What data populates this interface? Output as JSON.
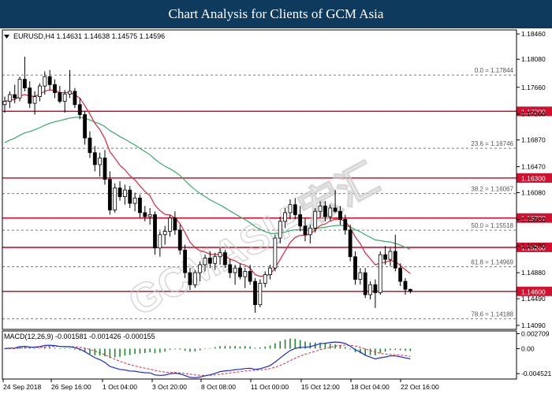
{
  "banner": {
    "title": "Chart Analysis for Clients of GCM Asia"
  },
  "watermark": {
    "text": "GCMASIA宏汇"
  },
  "chart_data": [
    {
      "type": "candlestick",
      "title": "EURUSD,H4  1.14631 1.14638 1.14575 1.14596",
      "symbol": "EURUSD,H4",
      "ohlc_header": [
        "1.14631",
        "1.14638",
        "1.14575",
        "1.14596"
      ],
      "ylim": [
        1.1403,
        1.1852
      ],
      "y_ticks": [
        "1.18460",
        "1.18080",
        "1.17660",
        "1.17260",
        "1.16870",
        "1.16470",
        "1.16080",
        "1.15680",
        "1.15280",
        "1.14880",
        "1.14490",
        "1.14090"
      ],
      "x_labels": [
        "24 Sep 2018",
        "26 Sep 16:00",
        "1 Oct 04:00",
        "3 Oct 20:00",
        "8 Oct 08:00",
        "11 Oct 00:00",
        "15 Oct 12:00",
        "18 Oct 04:00",
        "22 Oct 16:00"
      ],
      "levels": [
        {
          "label": "1.17300",
          "value": 1.173
        },
        {
          "label": "1.16300",
          "value": 1.163
        },
        {
          "label": "1.15700",
          "value": 1.157
        },
        {
          "label": "1.15260",
          "value": 1.1526
        },
        {
          "label": "1.14600",
          "value": 1.146
        }
      ],
      "fibonacci": [
        {
          "label": "0.0 = 1.17844",
          "value": 1.17844
        },
        {
          "label": "23.6 = 1.16746",
          "value": 1.16746
        },
        {
          "label": "38.2 = 1.16067",
          "value": 1.16067
        },
        {
          "label": "50.0 = 1.15518",
          "value": 1.15518
        },
        {
          "label": "61.8 = 1.14969",
          "value": 1.14969
        },
        {
          "label": "78.6 = 1.14188",
          "value": 1.14188
        }
      ],
      "candles": [
        [
          1.174,
          1.1752,
          1.1728,
          1.1745
        ],
        [
          1.1745,
          1.176,
          1.1735,
          1.1755
        ],
        [
          1.1755,
          1.177,
          1.1742,
          1.175
        ],
        [
          1.175,
          1.1782,
          1.1745,
          1.1778
        ],
        [
          1.1778,
          1.1812,
          1.176,
          1.1765
        ],
        [
          1.1765,
          1.1775,
          1.1735,
          1.1742
        ],
        [
          1.1742,
          1.176,
          1.1725,
          1.1752
        ],
        [
          1.1752,
          1.1772,
          1.1745,
          1.1768
        ],
        [
          1.1768,
          1.179,
          1.1755,
          1.1782
        ],
        [
          1.1782,
          1.1792,
          1.1762,
          1.177
        ],
        [
          1.177,
          1.1778,
          1.175,
          1.1758
        ],
        [
          1.1758,
          1.1768,
          1.1742,
          1.1745
        ],
        [
          1.1745,
          1.1762,
          1.1728,
          1.1756
        ],
        [
          1.1756,
          1.1792,
          1.175,
          1.176
        ],
        [
          1.176,
          1.1765,
          1.1735,
          1.174
        ],
        [
          1.174,
          1.175,
          1.1718,
          1.1725
        ],
        [
          1.1725,
          1.173,
          1.168,
          1.169
        ],
        [
          1.169,
          1.17,
          1.166,
          1.1668
        ],
        [
          1.1668,
          1.1678,
          1.164,
          1.165
        ],
        [
          1.165,
          1.1668,
          1.1632,
          1.166
        ],
        [
          1.166,
          1.1672,
          1.162,
          1.1628
        ],
        [
          1.1628,
          1.164,
          1.1575,
          1.1582
        ],
        [
          1.1582,
          1.1622,
          1.1578,
          1.1615
        ],
        [
          1.1615,
          1.1625,
          1.1596,
          1.1602
        ],
        [
          1.1602,
          1.162,
          1.159,
          1.1612
        ],
        [
          1.1612,
          1.1618,
          1.1585,
          1.1592
        ],
        [
          1.1592,
          1.1608,
          1.158,
          1.16
        ],
        [
          1.16,
          1.1605,
          1.157,
          1.1578
        ],
        [
          1.1578,
          1.1588,
          1.1565,
          1.1572
        ],
        [
          1.1572,
          1.1585,
          1.156,
          1.1575
        ],
        [
          1.1575,
          1.158,
          1.1515,
          1.1525
        ],
        [
          1.1525,
          1.155,
          1.1512,
          1.1545
        ],
        [
          1.1545,
          1.1558,
          1.153,
          1.155
        ],
        [
          1.155,
          1.1575,
          1.1542,
          1.157
        ],
        [
          1.157,
          1.158,
          1.1545,
          1.1552
        ],
        [
          1.1552,
          1.156,
          1.1515,
          1.1522
        ],
        [
          1.1522,
          1.153,
          1.148,
          1.1488
        ],
        [
          1.1488,
          1.1495,
          1.1462,
          1.147
        ],
        [
          1.147,
          1.1492,
          1.1465,
          1.1488
        ],
        [
          1.1488,
          1.1505,
          1.1475,
          1.15
        ],
        [
          1.15,
          1.1515,
          1.149,
          1.151
        ],
        [
          1.151,
          1.152,
          1.1495,
          1.1502
        ],
        [
          1.1502,
          1.1518,
          1.1492,
          1.1512
        ],
        [
          1.1512,
          1.1525,
          1.15,
          1.1518
        ],
        [
          1.1518,
          1.1522,
          1.1495,
          1.15
        ],
        [
          1.15,
          1.1508,
          1.148,
          1.1488
        ],
        [
          1.1488,
          1.15,
          1.147,
          1.1495
        ],
        [
          1.1495,
          1.1502,
          1.1478,
          1.1482
        ],
        [
          1.1482,
          1.1495,
          1.1465,
          1.149
        ],
        [
          1.149,
          1.15,
          1.147,
          1.1475
        ],
        [
          1.1475,
          1.148,
          1.1428,
          1.144
        ],
        [
          1.144,
          1.1478,
          1.1436,
          1.1472
        ],
        [
          1.1472,
          1.149,
          1.1466,
          1.1485
        ],
        [
          1.1485,
          1.15,
          1.1478,
          1.1495
        ],
        [
          1.1495,
          1.1545,
          1.149,
          1.154
        ],
        [
          1.154,
          1.1572,
          1.1532,
          1.1565
        ],
        [
          1.1565,
          1.1585,
          1.1555,
          1.1578
        ],
        [
          1.1578,
          1.1598,
          1.1568,
          1.159
        ],
        [
          1.159,
          1.16,
          1.1568,
          1.1575
        ],
        [
          1.1575,
          1.1588,
          1.155,
          1.1558
        ],
        [
          1.1558,
          1.157,
          1.1535,
          1.1545
        ],
        [
          1.1545,
          1.156,
          1.1532,
          1.1555
        ],
        [
          1.1555,
          1.1585,
          1.1548,
          1.158
        ],
        [
          1.158,
          1.1595,
          1.157,
          1.1588
        ],
        [
          1.1588,
          1.1595,
          1.1565,
          1.1572
        ],
        [
          1.1572,
          1.159,
          1.1566,
          1.1585
        ],
        [
          1.1585,
          1.1612,
          1.1578,
          1.158
        ],
        [
          1.158,
          1.1588,
          1.156,
          1.1568
        ],
        [
          1.1568,
          1.1575,
          1.1545,
          1.1552
        ],
        [
          1.1552,
          1.156,
          1.1505,
          1.1512
        ],
        [
          1.1512,
          1.152,
          1.147,
          1.1478
        ],
        [
          1.1478,
          1.1495,
          1.147,
          1.1488
        ],
        [
          1.1488,
          1.1495,
          1.145,
          1.1455
        ],
        [
          1.1455,
          1.1475,
          1.1448,
          1.147
        ],
        [
          1.147,
          1.1478,
          1.1435,
          1.1458
        ],
        [
          1.1458,
          1.152,
          1.1455,
          1.1515
        ],
        [
          1.1515,
          1.1528,
          1.15,
          1.1508
        ],
        [
          1.1508,
          1.1525,
          1.1498,
          1.152
        ],
        [
          1.152,
          1.1545,
          1.149,
          1.1495
        ],
        [
          1.1495,
          1.1502,
          1.1468,
          1.1475
        ],
        [
          1.1475,
          1.148,
          1.1455,
          1.1463
        ],
        [
          1.1463,
          1.1464,
          1.1457,
          1.146
        ]
      ],
      "ma_fast_color": "#e0263c",
      "ma_slow_color": "#3aaa6a",
      "level_color": "#d0102e",
      "macd": {
        "title": "MACD(12,26,9) -0.001581 -0.001426 -0.000155",
        "ylim": [
          -0.0055,
          0.0032
        ],
        "y_ticks": [
          "0.002709",
          "0.00",
          "-0.004521"
        ],
        "macd_color": "#1a2bd6",
        "signal_color": "#e0263c",
        "hist_color": "#1e8a2e"
      }
    }
  ]
}
